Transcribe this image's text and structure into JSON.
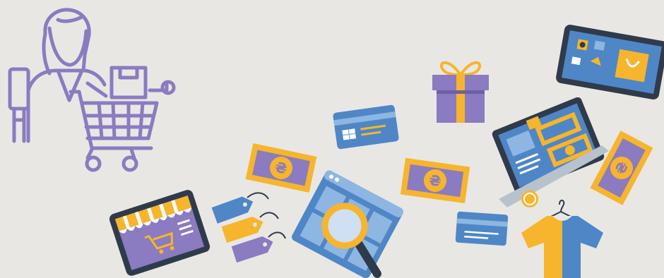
{
  "scene": {
    "colors": {
      "background": "#e9e7e4",
      "purple": "#8b7bc0",
      "purple_dark": "#6d5fa8",
      "blue": "#4f86c6",
      "blue_light": "#8db6e2",
      "yellow": "#f6b52c",
      "dark": "#2f3b4a",
      "white": "#ffffff"
    },
    "currency_symbol": "₴",
    "elements": [
      "shopper-with-cart-line-icon",
      "online-store-tablet-icon",
      "price-tags-icon",
      "banknote-icon",
      "browser-magnifier-icon",
      "credit-card-icon",
      "gift-box-icon",
      "shopping-tablet-icon",
      "laptop-with-money-icon",
      "coin-icon",
      "t-shirt-on-hanger-icon"
    ]
  }
}
